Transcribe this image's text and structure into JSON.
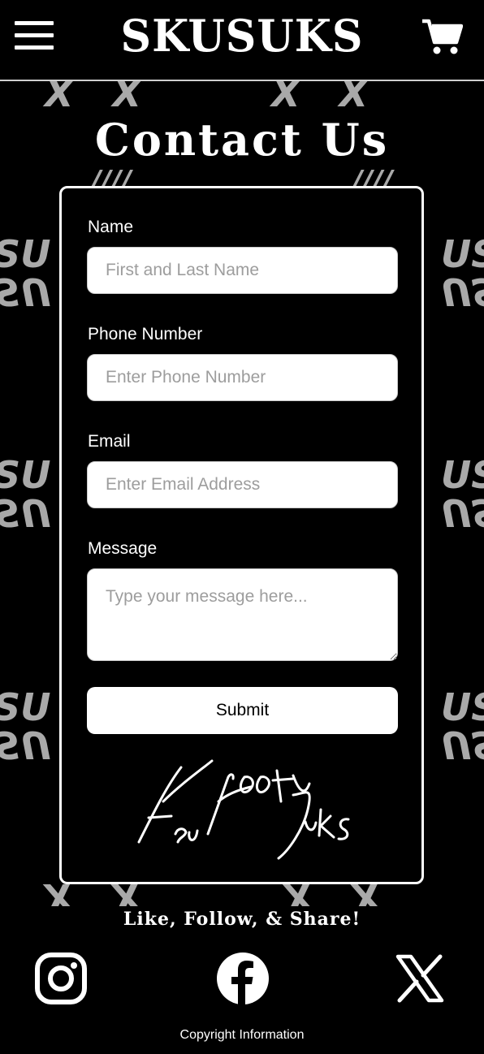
{
  "header": {
    "logo_text": "SKUSUKS",
    "menu_icon": "hamburger-menu-icon",
    "cart_icon": "shopping-cart-icon"
  },
  "page": {
    "title": "Contact Us"
  },
  "form": {
    "name_label": "Name",
    "name_placeholder": "First and Last Name",
    "phone_label": "Phone Number",
    "phone_placeholder": "Enter Phone Number",
    "email_label": "Email",
    "email_placeholder": "Enter Email Address",
    "message_label": "Message",
    "message_placeholder": "Type your message here...",
    "submit_label": "Submit",
    "signature_text": "Keu Hoot Yuks"
  },
  "social": {
    "heading": "Like, Follow, & Share!",
    "icons": [
      "instagram-icon",
      "facebook-icon",
      "x-icon"
    ]
  },
  "footer": {
    "copyright": "Copyright Information"
  },
  "colors": {
    "background": "#000000",
    "foreground": "#ffffff",
    "pattern": "#a9a9a9",
    "placeholder": "#9d9d9d"
  }
}
